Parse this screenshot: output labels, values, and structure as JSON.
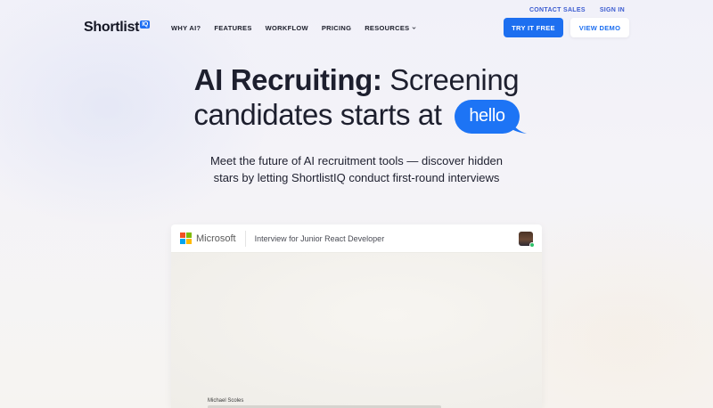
{
  "topbar": {
    "contact_sales": "CONTACT SALES",
    "sign_in": "SIGN IN"
  },
  "brand": {
    "name": "Shortlist",
    "badge": "IQ",
    "accent": "#1d6ff0"
  },
  "nav": {
    "items": [
      {
        "label": "WHY AI?"
      },
      {
        "label": "FEATURES"
      },
      {
        "label": "WORKFLOW"
      },
      {
        "label": "PRICING"
      },
      {
        "label": "RESOURCES",
        "icon": "chevron-down-icon"
      }
    ]
  },
  "actions": {
    "primary": "TRY IT FREE",
    "secondary": "VIEW DEMO"
  },
  "hero": {
    "headline_strong": "AI Recruiting:",
    "headline_rest1": " Screening",
    "headline_line2": "candidates starts at",
    "bubble": "hello",
    "bubble_color": "#1d74f5",
    "subhead_line1": "Meet the future of AI recruitment tools — discover hidden",
    "subhead_line2": "stars by letting ShortlistIQ conduct first-round interviews"
  },
  "demo_card": {
    "company": "Microsoft",
    "title": "Interview for Junior React Developer",
    "candidate_name": "Michael Scoles",
    "status_color": "#2ec26a"
  }
}
